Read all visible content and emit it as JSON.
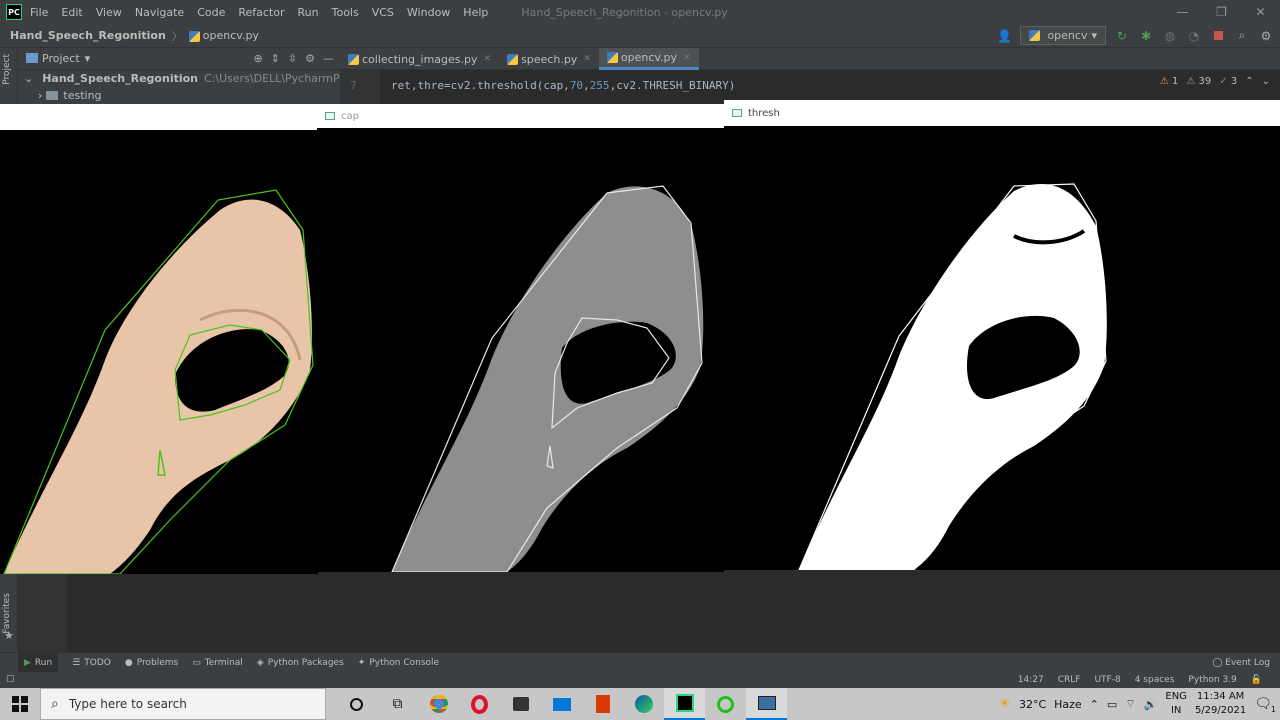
{
  "titlebar": {
    "menu": [
      "File",
      "Edit",
      "View",
      "Navigate",
      "Code",
      "Refactor",
      "Run",
      "Tools",
      "VCS",
      "Window",
      "Help"
    ],
    "title": "Hand_Speech_Regonition - opencv.py",
    "min": "—",
    "max": "❐",
    "close": "✕"
  },
  "navbar": {
    "project": "Hand_Speech_Regonition",
    "file": "opencv.py",
    "run_config": "opencv"
  },
  "leftstrip": {
    "project": "Project",
    "favorites": "Favorites"
  },
  "project_panel": {
    "header": "Project",
    "root_name": "Hand_Speech_Regonition",
    "root_path": "C:\\Users\\DELL\\PycharmProjects\\Hand",
    "child": "testing"
  },
  "tabs": [
    {
      "label": "collecting_images.py"
    },
    {
      "label": "speech.py"
    },
    {
      "label": "opencv.py"
    }
  ],
  "editor": {
    "line_number": "7",
    "code_prefix": "ret,thre=cv2.threshold(cap,",
    "num1": "70",
    "num2": "255",
    "code_suffix": "cv2.THRESH_BINARY)",
    "warnings": "1",
    "weak": "39",
    "typos": "3"
  },
  "windows": {
    "cap": "cap",
    "thresh": "thresh"
  },
  "toolwindows": {
    "run": "Run",
    "todo": "TODO",
    "problems": "Problems",
    "terminal": "Terminal",
    "packages": "Python Packages",
    "console": "Python Console",
    "event_log": "Event Log"
  },
  "statusbar": {
    "position": "14:27",
    "line_sep": "CRLF",
    "encoding": "UTF-8",
    "indent": "4 spaces",
    "interpreter": "Python 3.9"
  },
  "taskbar": {
    "search_placeholder": "Type here to search",
    "weather_temp": "32°C",
    "weather_desc": "Haze",
    "lang": "ENG",
    "region": "IN",
    "time": "11:34 AM",
    "date": "5/29/2021",
    "notif_count": "1"
  },
  "colors": {
    "accent": "#4a88c7",
    "hull_green": "#4cc41a",
    "ide_bg": "#2b2b2b",
    "panel_bg": "#3c3f41"
  }
}
